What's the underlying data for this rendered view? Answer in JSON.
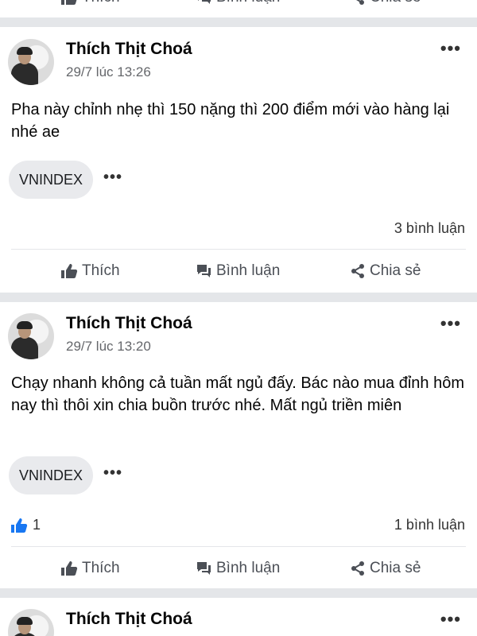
{
  "top_actions": {
    "like": "Thích",
    "comment": "Bình luận",
    "share": "Chia sẻ"
  },
  "posts": [
    {
      "author": "Thích Thịt Choá",
      "time": "29/7 lúc 13:26",
      "content": "Pha này chỉnh nhẹ thì 150 nặng thì 200 điểm mới vào hàng lại nhé ae",
      "tag": "VNINDEX",
      "comment_count": "3 bình luận",
      "actions": {
        "like": "Thích",
        "comment": "Bình luận",
        "share": "Chia sẻ"
      }
    },
    {
      "author": "Thích Thịt Choá",
      "time": "29/7 lúc 13:20",
      "content": "Chạy nhanh không cả tuần mất ngủ đấy. Bác nào mua đỉnh hôm nay thì thôi xin chia buồn trước nhé. Mất ngủ triền miên",
      "tag": "VNINDEX",
      "like_count": "1",
      "comment_count": "1 bình luận",
      "actions": {
        "like": "Thích",
        "comment": "Bình luận",
        "share": "Chia sẻ"
      }
    },
    {
      "author": "Thích Thịt Choá"
    }
  ],
  "colors": {
    "separator": "#e4e6e9",
    "like_blue": "#1877f2",
    "action_gray": "#4b4f56"
  }
}
